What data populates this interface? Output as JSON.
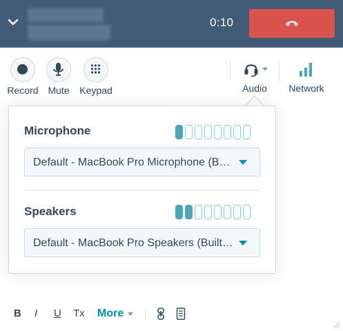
{
  "header": {
    "timer": "0:10",
    "collapse_icon": "chevron-down-icon",
    "hangup_icon": "phone-hangup-icon",
    "colors": {
      "background": "#425b76",
      "hangup": "#d9534f"
    }
  },
  "toolbar": {
    "record_label": "Record",
    "mute_label": "Mute",
    "keypad_label": "Keypad",
    "audio_label": "Audio",
    "network_label": "Network"
  },
  "audio_popover": {
    "microphone": {
      "title": "Microphone",
      "level": 1,
      "level_max": 8,
      "selected_device": "Default - MacBook Pro Microphone (Built-in)"
    },
    "speakers": {
      "title": "Speakers",
      "level": 2,
      "level_max": 8,
      "selected_device": "Default - MacBook Pro Speakers (Built-in)"
    },
    "colors": {
      "meter_on": "#4da5b8",
      "meter_off_border": "#7fd1de",
      "caret": "#0091ae"
    }
  },
  "editor_toolbar": {
    "bold": "B",
    "italic": "I",
    "underline": "U",
    "clear_format": "Tx",
    "more_label": "More"
  }
}
